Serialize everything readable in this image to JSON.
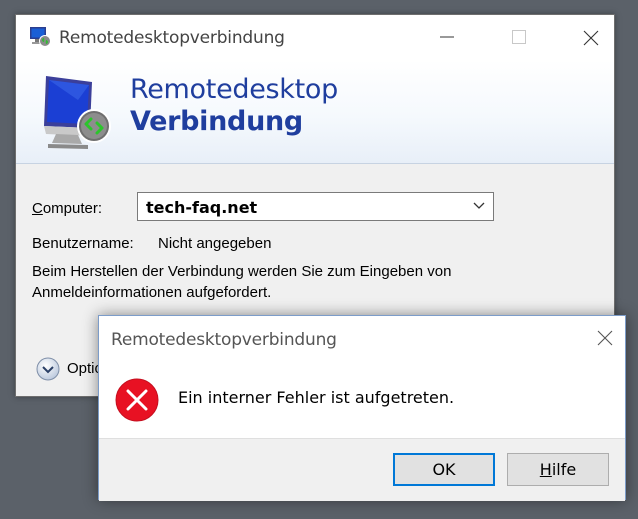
{
  "main_window": {
    "title": "Remotedesktopverbindung",
    "banner": {
      "line1": "Remotedesktop",
      "line2": "Verbindung"
    },
    "computer": {
      "label_first": "C",
      "label_rest": "omputer:",
      "value": "tech-faq.net"
    },
    "username": {
      "label": "Benutzername:",
      "value": "Nicht angegeben"
    },
    "info_text": "Beim Herstellen der Verbindung werden Sie zum Eingeben von Anmeldeinformationen aufgefordert.",
    "options_label": "Optio"
  },
  "dialog": {
    "title": "Remotedesktopverbindung",
    "message": "Ein interner Fehler ist aufgetreten.",
    "ok_label": "OK",
    "help_label_first": "H",
    "help_label_rest": "ilfe"
  },
  "icons": {
    "app": "remote-desktop-icon",
    "error": "error-x-icon",
    "options": "chevron-down-circle-icon"
  },
  "colors": {
    "accent": "#0078d7",
    "banner_text": "#1f3e9e",
    "error_red": "#e81123"
  }
}
